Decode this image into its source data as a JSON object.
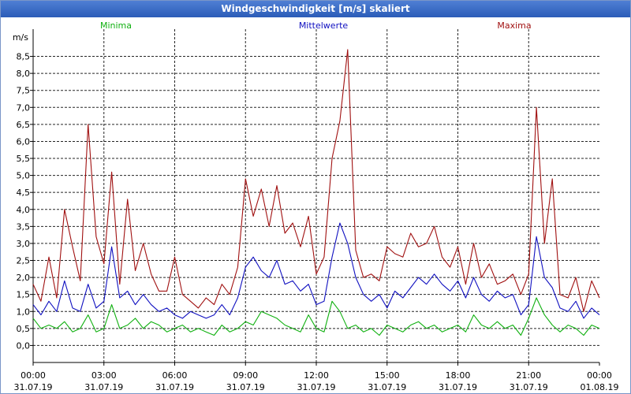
{
  "window": {
    "title": "Windgeschwindigkeit [m/s] skaliert"
  },
  "chart_data": {
    "type": "line",
    "title": "Windgeschwindigkeit [m/s] skaliert",
    "ylabel": "m/s",
    "xlabel": "",
    "ylim": [
      -0.5,
      9.3
    ],
    "xlim": [
      0,
      24
    ],
    "grid": true,
    "y_ticks": [
      "0,0",
      "0,5",
      "1,0",
      "1,5",
      "2,0",
      "2,5",
      "3,0",
      "3,5",
      "4,0",
      "4,5",
      "5,0",
      "5,5",
      "6,0",
      "6,5",
      "7,0",
      "7,5",
      "8,0",
      "8,5"
    ],
    "x_ticks": [
      {
        "time": "00:00",
        "date": "31.07.19"
      },
      {
        "time": "03:00",
        "date": "31.07.19"
      },
      {
        "time": "06:00",
        "date": "31.07.19"
      },
      {
        "time": "09:00",
        "date": "31.07.19"
      },
      {
        "time": "12:00",
        "date": "31.07.19"
      },
      {
        "time": "15:00",
        "date": "31.07.19"
      },
      {
        "time": "18:00",
        "date": "31.07.19"
      },
      {
        "time": "21:00",
        "date": "31.07.19"
      },
      {
        "time": "00:00",
        "date": "01.08.19"
      }
    ],
    "legend": {
      "placement": "top"
    },
    "series": [
      {
        "name": "Minima",
        "color": "#10b010",
        "x": [
          0,
          0.33,
          0.67,
          1,
          1.33,
          1.67,
          2,
          2.33,
          2.67,
          3,
          3.33,
          3.67,
          4,
          4.33,
          4.67,
          5,
          5.33,
          5.67,
          6,
          6.33,
          6.67,
          7,
          7.33,
          7.67,
          8,
          8.33,
          8.67,
          9,
          9.33,
          9.67,
          10,
          10.33,
          10.67,
          11,
          11.33,
          11.67,
          12,
          12.33,
          12.67,
          13,
          13.33,
          13.67,
          14,
          14.33,
          14.67,
          15,
          15.33,
          15.67,
          16,
          16.33,
          16.67,
          17,
          17.33,
          17.67,
          18,
          18.33,
          18.67,
          19,
          19.33,
          19.67,
          20,
          20.33,
          20.67,
          21,
          21.33,
          21.67,
          22,
          22.33,
          22.67,
          23,
          23.33,
          23.67,
          24
        ],
        "values": [
          0.8,
          0.5,
          0.6,
          0.5,
          0.7,
          0.4,
          0.5,
          0.9,
          0.4,
          0.5,
          1.2,
          0.5,
          0.6,
          0.8,
          0.5,
          0.7,
          0.6,
          0.4,
          0.5,
          0.6,
          0.4,
          0.5,
          0.4,
          0.3,
          0.6,
          0.4,
          0.5,
          0.7,
          0.6,
          1.0,
          0.9,
          0.8,
          0.6,
          0.5,
          0.4,
          0.9,
          0.5,
          0.4,
          1.3,
          1.0,
          0.5,
          0.6,
          0.4,
          0.5,
          0.3,
          0.6,
          0.5,
          0.4,
          0.6,
          0.7,
          0.5,
          0.6,
          0.4,
          0.5,
          0.6,
          0.4,
          0.9,
          0.6,
          0.5,
          0.7,
          0.5,
          0.6,
          0.3,
          0.8,
          1.4,
          0.9,
          0.6,
          0.4,
          0.6,
          0.5,
          0.3,
          0.6,
          0.5
        ]
      },
      {
        "name": "Mittelwerte",
        "color": "#1010c0",
        "x": [
          0,
          0.33,
          0.67,
          1,
          1.33,
          1.67,
          2,
          2.33,
          2.67,
          3,
          3.33,
          3.67,
          4,
          4.33,
          4.67,
          5,
          5.33,
          5.67,
          6,
          6.33,
          6.67,
          7,
          7.33,
          7.67,
          8,
          8.33,
          8.67,
          9,
          9.33,
          9.67,
          10,
          10.33,
          10.67,
          11,
          11.33,
          11.67,
          12,
          12.33,
          12.67,
          13,
          13.33,
          13.67,
          14,
          14.33,
          14.67,
          15,
          15.33,
          15.67,
          16,
          16.33,
          16.67,
          17,
          17.33,
          17.67,
          18,
          18.33,
          18.67,
          19,
          19.33,
          19.67,
          20,
          20.33,
          20.67,
          21,
          21.33,
          21.67,
          22,
          22.33,
          22.67,
          23,
          23.33,
          23.67,
          24
        ],
        "values": [
          1.2,
          0.9,
          1.3,
          1.0,
          1.9,
          1.1,
          1.0,
          1.8,
          1.1,
          1.3,
          2.9,
          1.4,
          1.6,
          1.2,
          1.5,
          1.2,
          1.0,
          1.1,
          0.9,
          0.8,
          1.0,
          0.9,
          0.8,
          0.9,
          1.2,
          0.9,
          1.4,
          2.3,
          2.6,
          2.2,
          2.0,
          2.5,
          1.8,
          1.9,
          1.6,
          1.8,
          1.2,
          1.3,
          2.6,
          3.6,
          3.0,
          2.0,
          1.5,
          1.3,
          1.5,
          1.1,
          1.6,
          1.4,
          1.7,
          2.0,
          1.8,
          2.1,
          1.8,
          1.6,
          1.9,
          1.4,
          2.0,
          1.5,
          1.3,
          1.6,
          1.4,
          1.5,
          0.9,
          1.2,
          3.2,
          2.0,
          1.7,
          1.1,
          1.0,
          1.3,
          0.8,
          1.1,
          0.9
        ]
      },
      {
        "name": "Maxima",
        "color": "#a01010",
        "x": [
          0,
          0.33,
          0.67,
          1,
          1.33,
          1.67,
          2,
          2.33,
          2.67,
          3,
          3.33,
          3.67,
          4,
          4.33,
          4.67,
          5,
          5.33,
          5.67,
          6,
          6.33,
          6.67,
          7,
          7.33,
          7.67,
          8,
          8.33,
          8.67,
          9,
          9.33,
          9.67,
          10,
          10.33,
          10.67,
          11,
          11.33,
          11.67,
          12,
          12.33,
          12.67,
          13,
          13.33,
          13.67,
          14,
          14.33,
          14.67,
          15,
          15.33,
          15.67,
          16,
          16.33,
          16.67,
          17,
          17.33,
          17.67,
          18,
          18.33,
          18.67,
          19,
          19.33,
          19.67,
          20,
          20.33,
          20.67,
          21,
          21.33,
          21.67,
          22,
          22.33,
          22.67,
          23,
          23.33,
          23.67,
          24
        ],
        "values": [
          1.8,
          1.3,
          2.6,
          1.4,
          4.0,
          2.9,
          1.9,
          6.5,
          3.2,
          2.4,
          5.1,
          1.8,
          4.3,
          2.2,
          3.0,
          2.1,
          1.6,
          1.6,
          2.6,
          1.5,
          1.3,
          1.1,
          1.4,
          1.2,
          1.8,
          1.5,
          2.3,
          4.9,
          3.8,
          4.6,
          3.5,
          4.7,
          3.3,
          3.6,
          2.9,
          3.8,
          2.1,
          2.6,
          5.5,
          6.6,
          8.7,
          2.8,
          2.0,
          2.1,
          1.9,
          2.9,
          2.7,
          2.6,
          3.3,
          2.9,
          3.0,
          3.5,
          2.6,
          2.3,
          2.9,
          1.8,
          3.0,
          2.0,
          2.4,
          1.8,
          1.9,
          2.1,
          1.5,
          2.1,
          7.0,
          3.0,
          4.9,
          1.5,
          1.4,
          2.0,
          1.0,
          1.9,
          1.4
        ]
      }
    ]
  }
}
